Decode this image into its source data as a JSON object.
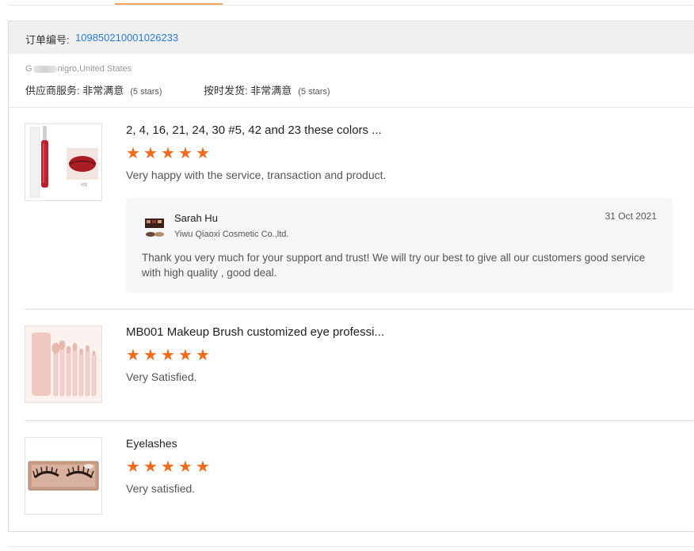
{
  "order": {
    "number_label": "订单编号:",
    "number_value": "109850210001026233",
    "buyer_location_prefix": "G",
    "buyer_location_suffix": "nigro,United States",
    "supplier_service_label": "供应商服务: 非常满意",
    "supplier_service_stars": "(5 stars)",
    "on_time_label": "按时发货: 非常满意",
    "on_time_stars": "(5 stars)"
  },
  "items": [
    {
      "title": "2, 4, 16, 21, 24, 30 #5, 42 and 23 these colors ...",
      "rating": 5,
      "comment": "Very happy with the service, transaction and product.",
      "thumb_icon": "lip-gloss-icon",
      "reply": {
        "name": "Sarah Hu",
        "company": "Yiwu Qiaoxi Cosmetic Co.,ltd.",
        "date": "31 Oct 2021",
        "text": "Thank you very much for your support and trust! We will try our best to give all our customers good service with high quality , good deal."
      }
    },
    {
      "title": "MB001 Makeup Brush customized eye professi...",
      "rating": 5,
      "comment": "Very Satisfied.",
      "thumb_icon": "makeup-brush-set-icon"
    },
    {
      "title": "Eyelashes",
      "rating": 5,
      "comment": "Very satisfied.",
      "thumb_icon": "eyelashes-icon"
    }
  ],
  "colors": {
    "star": "#f26a1b",
    "link": "#2a7ad6",
    "header_bg": "#f0f0f0",
    "reply_bg": "#f5f6f8"
  }
}
